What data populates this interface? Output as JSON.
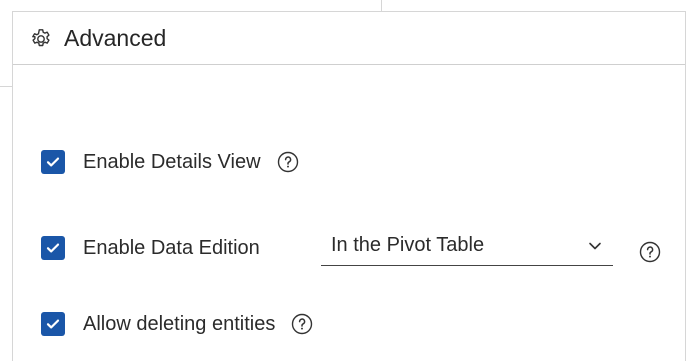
{
  "panel": {
    "title": "Advanced",
    "title_icon": "gear-icon"
  },
  "options": [
    {
      "label": "Enable Details View",
      "checked": true,
      "help_icon": "help-icon"
    },
    {
      "label": "Enable Data Edition",
      "checked": true,
      "help_icon": "help-icon"
    },
    {
      "label": "Allow deleting entities",
      "checked": true,
      "help_icon": "help-icon"
    }
  ],
  "data_edition_select": {
    "value": "In the Pivot Table",
    "icon": "chevron-down-icon"
  },
  "colors": {
    "checkbox": "#1a56a8",
    "border": "#d6d6d6"
  }
}
